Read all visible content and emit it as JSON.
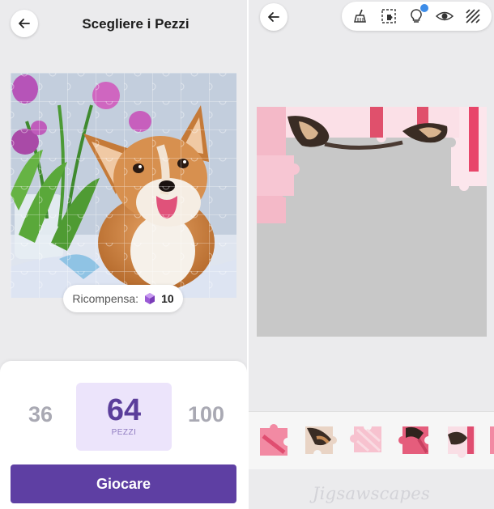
{
  "left_screen": {
    "title": "Scegliere i Pezzi",
    "back_icon": "arrow-left-icon",
    "reward": {
      "label": "Ricompensa:",
      "icon": "purple-gem-icon",
      "value": "10"
    },
    "piece_options": [
      {
        "value": "36",
        "selected": false
      },
      {
        "value": "64",
        "selected": true,
        "unit": "PEZZI"
      },
      {
        "value": "100",
        "selected": false
      }
    ],
    "play_button": "Giocare",
    "colors": {
      "accent": "#5e3fa3",
      "selected_bg": "#ece4fb",
      "selected_text": "#5b3e9b"
    }
  },
  "right_screen": {
    "back_icon": "arrow-left-icon",
    "toolbar": [
      {
        "icon": "broom-icon"
      },
      {
        "icon": "select-pieces-icon"
      },
      {
        "icon": "lightbulb-hint-icon"
      },
      {
        "icon": "eye-preview-icon"
      },
      {
        "icon": "background-pattern-icon"
      }
    ],
    "tray_piece_count_visible": 6,
    "watermark": "Jigsawscapes"
  }
}
